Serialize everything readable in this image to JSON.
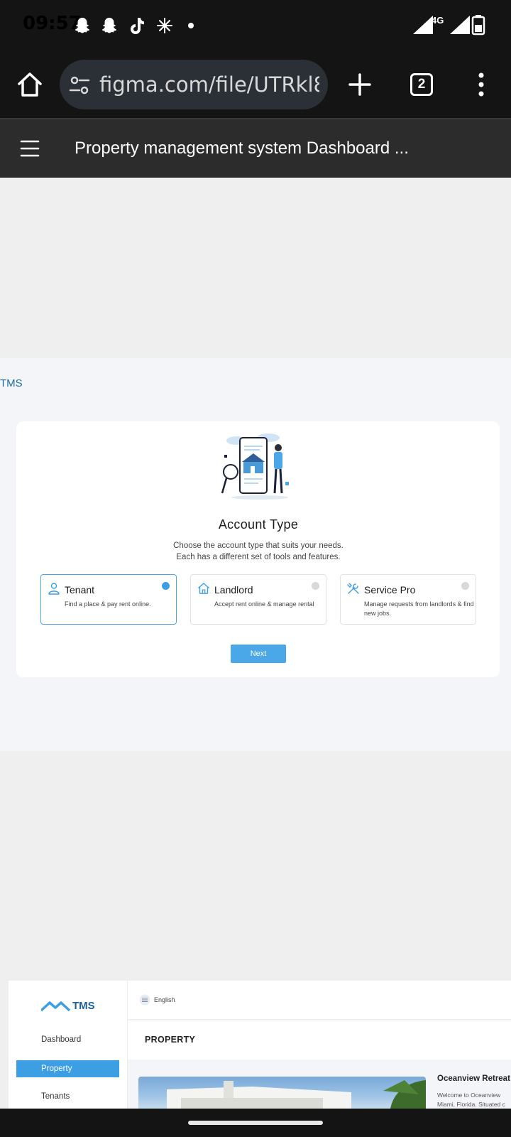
{
  "status_bar": {
    "time": "09:57",
    "network": "4G"
  },
  "browser": {
    "url": "figma.com/file/UTRkl8M",
    "tab_count": "2"
  },
  "figma": {
    "file_title": "Property management system Dashboard ..."
  },
  "onboarding": {
    "brand_label": "TMS",
    "title": "Account Type",
    "subtitle_line1": "Choose the account type that suits your needs.",
    "subtitle_line2": "Each has a different set of tools and features.",
    "options": [
      {
        "title": "Tenant",
        "description": "Find a place & pay rent online.",
        "selected": true,
        "icon": "user-icon"
      },
      {
        "title": "Landlord",
        "description": "Accept rent online & manage rental",
        "selected": false,
        "icon": "house-icon"
      },
      {
        "title": "Service Pro",
        "description": "Manage requests from landlords & find new jobs.",
        "selected": false,
        "icon": "tools-icon"
      }
    ],
    "next_label": "Next"
  },
  "dashboard": {
    "logo_text": "TMS",
    "language": "English",
    "sidebar": [
      {
        "label": "Dashboard",
        "active": false
      },
      {
        "label": "Property",
        "active": true
      },
      {
        "label": "Tenants",
        "active": false
      }
    ],
    "section_title": "PROPERTY",
    "property_name": "Oceanview Retreat",
    "property_desc_line1": "Welcome to Oceanview",
    "property_desc_line2": "Miami, Florida. Situated c"
  },
  "colors": {
    "accent": "#3d9fe3",
    "brand": "#1f5f9a",
    "chrome_dark": "#141414",
    "figma_header": "#2c2c2c"
  }
}
